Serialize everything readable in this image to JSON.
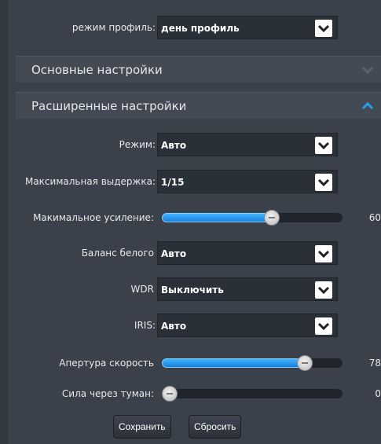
{
  "profile_mode": {
    "label": "режим профиль:",
    "value": "день профиль"
  },
  "sections": {
    "basic": {
      "title": "Основные настройки",
      "expanded": false
    },
    "advanced": {
      "title": "Расширенные настройки",
      "expanded": true
    }
  },
  "fields": {
    "mode": {
      "label": "Режим:",
      "value": "Авто"
    },
    "max_shutter": {
      "label": "Максимальная выдержка:",
      "value": "1/15"
    },
    "max_gain": {
      "label": "Макимальное усиление:",
      "value": "60",
      "level": 0.62
    },
    "white_balance": {
      "label": "Баланс белого",
      "value": "Авто"
    },
    "wdr": {
      "label": "WDR",
      "value": "Выключить"
    },
    "iris": {
      "label": "IRIS:",
      "value": "Авто"
    },
    "aperture_speed": {
      "label": "Апертура скорость",
      "value": "78",
      "level": 0.82
    },
    "defog_strength": {
      "label": "Сила через туман:",
      "value": "0",
      "level": 0.0
    }
  },
  "buttons": {
    "save": "Сохранить",
    "reset": "Сбросить"
  },
  "colors": {
    "background": "#3a414a",
    "section": "#434a54",
    "accent": "#2a9cf0",
    "chevron_active": "#2a9cf0"
  },
  "icons": {
    "dropdown": "chevron-down-icon",
    "collapse": "chevron-up-icon",
    "expand": "chevron-down-icon"
  }
}
